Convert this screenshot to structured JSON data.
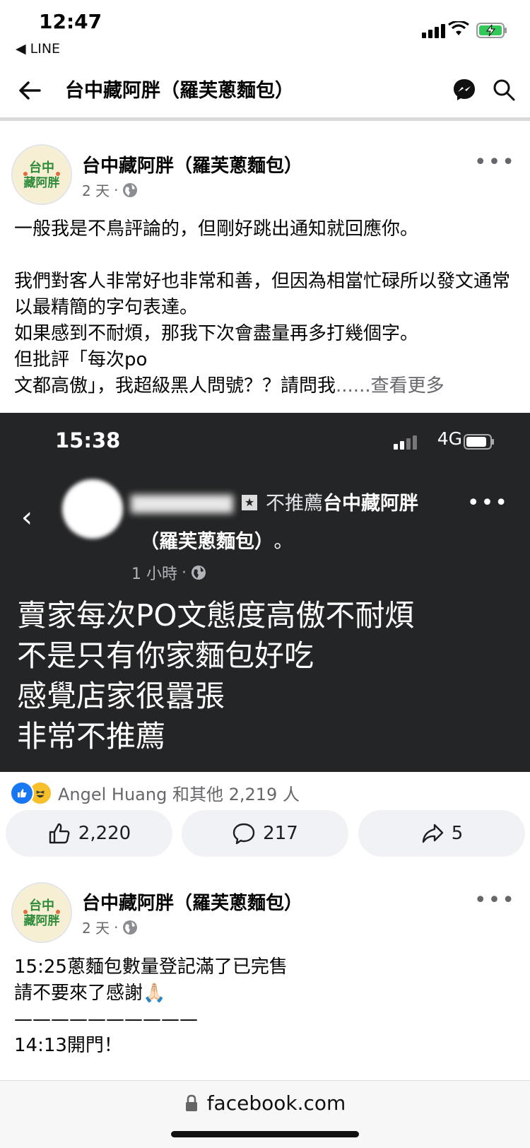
{
  "status_bar": {
    "time": "12:47",
    "back_app": "◀ LINE"
  },
  "nav": {
    "title": "台中藏阿胖（羅芙蔥麵包）"
  },
  "post1": {
    "author": "台中藏阿胖（羅芙蔥麵包）",
    "time": "2 天",
    "text": "一般我是不鳥評論的，但剛好跳出通知就回應你。\n\n我們對客人非常好也非常和善，但因為相當忙碌所以發文通常以最精簡的字句表達。\n如果感到不耐煩，那我下次會盡量再多打幾個字。\n但批評「每次po\n文都高傲」，我超級黑人問號？？請問我",
    "see_more": "......查看更多"
  },
  "screenshot": {
    "time": "15:38",
    "network": "4G",
    "review_prefix": "不推薦",
    "review_page": "台中藏阿胖",
    "review_page_line2": "（羅芙蔥麵包）",
    "review_period": "。",
    "review_time": "1 小時",
    "review_body": "賣家每次PO文態度高傲不耐煩\n不是只有你家麵包好吃\n感覺店家很囂張\n非常不推薦"
  },
  "reactions": {
    "summary": "Angel Huang 和其他 2,219 人"
  },
  "actions": {
    "likes": "2,220",
    "comments": "217",
    "shares": "5"
  },
  "post2": {
    "author": "台中藏阿胖（羅芙蔥麵包）",
    "time": "2 天",
    "text": "15:25蔥麵包數量登記滿了已完售\n請不要來了感謝🙏🏻\n——————————\n14:13開門！"
  },
  "avatar_text": "台中 藏阿胖",
  "url_bar": {
    "domain": "facebook.com"
  },
  "colors": {
    "brand_blue": "#1877f2",
    "dark_bg": "#242526",
    "muted": "#65676b",
    "button_bg": "#f0f2f5"
  },
  "icons": [
    "back-arrow-icon",
    "messenger-icon",
    "search-icon",
    "globe-icon",
    "more-icon",
    "like-icon",
    "comment-icon",
    "share-icon",
    "lock-icon"
  ]
}
